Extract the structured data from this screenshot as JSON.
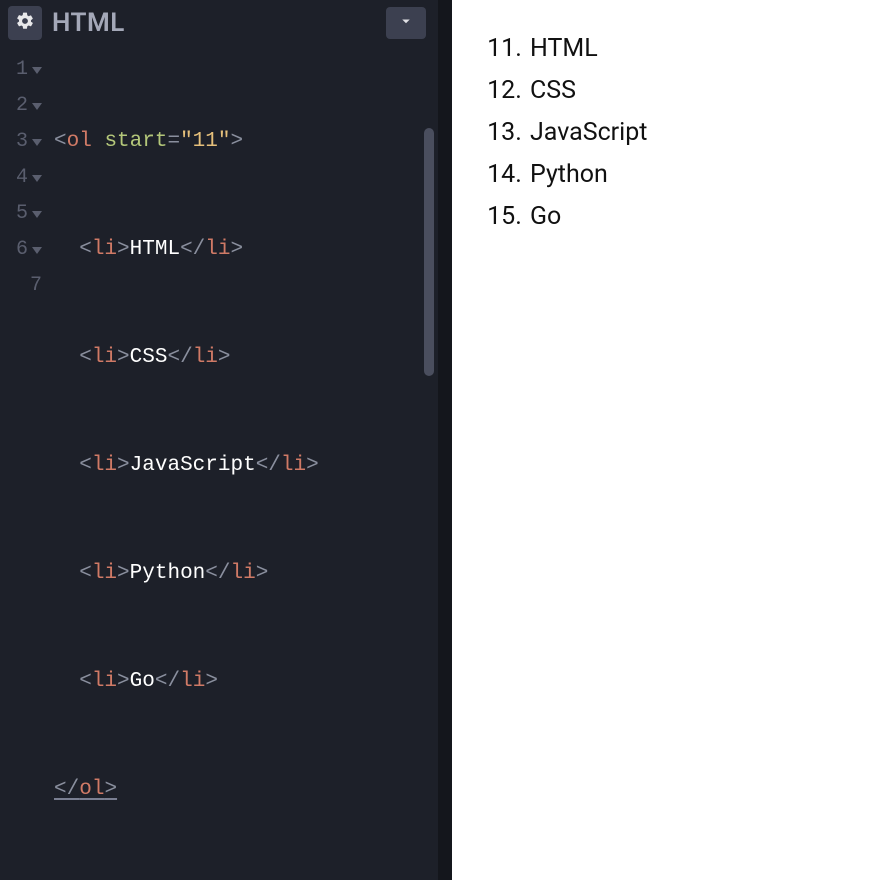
{
  "editor": {
    "title": "HTML",
    "code": {
      "start_attr_value": "11",
      "items": [
        "HTML",
        "CSS",
        "JavaScript",
        "Python",
        "Go"
      ]
    },
    "gutter": [
      "1",
      "2",
      "3",
      "4",
      "5",
      "6",
      "7"
    ]
  },
  "preview": {
    "start": 11,
    "items": [
      "HTML",
      "CSS",
      "JavaScript",
      "Python",
      "Go"
    ]
  }
}
